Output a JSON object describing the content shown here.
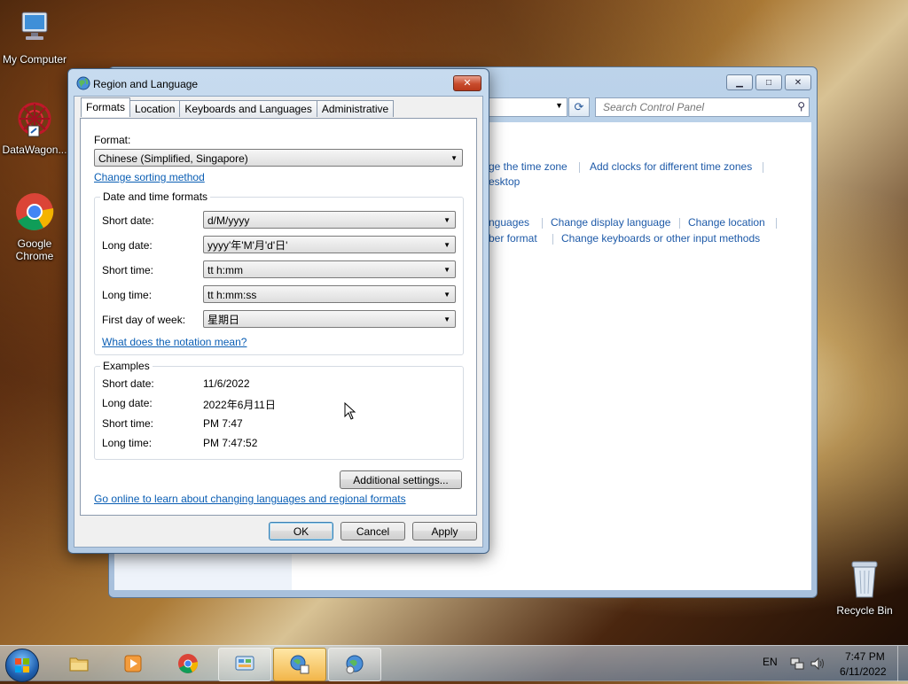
{
  "desktop": {
    "icons": [
      {
        "label": "My Computer"
      },
      {
        "label": "DataWagon..."
      },
      {
        "label": "Google Chrome"
      },
      {
        "label": "Recycle Bin"
      }
    ]
  },
  "control_panel": {
    "search_placeholder": "Search Control Panel",
    "links": [
      "ge the time zone",
      "Add clocks for different time zones",
      "esktop",
      "nguages",
      "Change display language",
      "Change location",
      "ber format",
      "Change keyboards or other input methods"
    ]
  },
  "dialog": {
    "title": "Region and Language",
    "close_label": "✕",
    "tabs": [
      "Formats",
      "Location",
      "Keyboards and Languages",
      "Administrative"
    ],
    "format_label": "Format:",
    "format_value": "Chinese (Simplified, Singapore)",
    "change_sorting": "Change sorting method",
    "datetime_group": "Date and time formats",
    "fields": [
      {
        "label": "Short date:",
        "value": "d/M/yyyy"
      },
      {
        "label": "Long date:",
        "value": "yyyy'年'M'月'd'日'"
      },
      {
        "label": "Short time:",
        "value": "tt h:mm"
      },
      {
        "label": "Long time:",
        "value": "tt h:mm:ss"
      },
      {
        "label": "First day of week:",
        "value": "星期日"
      }
    ],
    "notation_link": "What does the notation mean?",
    "examples_group": "Examples",
    "examples": [
      {
        "label": "Short date:",
        "value": "11/6/2022"
      },
      {
        "label": "Long date:",
        "value": "2022年6月11日"
      },
      {
        "label": "Short time:",
        "value": "PM 7:47"
      },
      {
        "label": "Long time:",
        "value": "PM 7:47:52"
      }
    ],
    "additional_settings": "Additional settings...",
    "online_link": "Go online to learn about changing languages and regional formats",
    "ok": "OK",
    "cancel": "Cancel",
    "apply": "Apply"
  },
  "taskbar": {
    "language": "EN",
    "time": "7:47 PM",
    "date": "6/11/2022"
  }
}
